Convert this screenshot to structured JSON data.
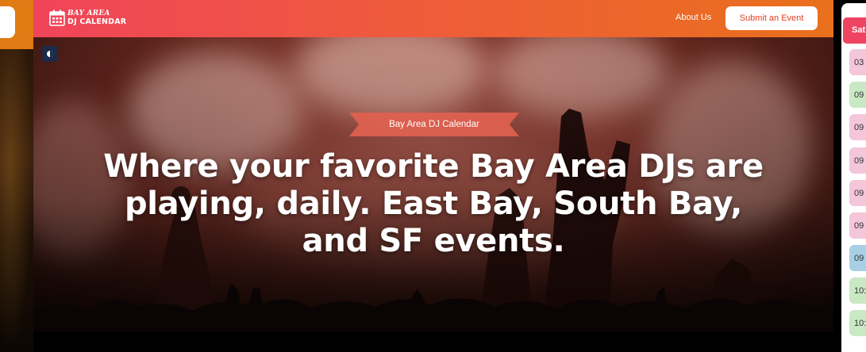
{
  "app": {
    "logo_top": "BAY AREA",
    "logo_bottom": "DJ CALENDAR"
  },
  "nav": {
    "about_label": "About Us",
    "submit_label": "Submit an Event"
  },
  "hero": {
    "ribbon_label": "Bay Area DJ Calendar",
    "headline": "Where your favorite Bay Area DJs are playing, daily. East Bay, South Bay, and SF events."
  },
  "calendar": {
    "day_header": "Sat",
    "times": [
      {
        "text": "03",
        "color": "pink"
      },
      {
        "text": "09",
        "color": "green"
      },
      {
        "text": "09",
        "color": "pink"
      },
      {
        "text": "09",
        "color": "pink"
      },
      {
        "text": "09",
        "color": "pink"
      },
      {
        "text": "09",
        "color": "pink"
      },
      {
        "text": "09",
        "color": "blue"
      },
      {
        "text": "10:",
        "color": "green"
      },
      {
        "text": "10:",
        "color": "green"
      }
    ]
  },
  "colors": {
    "nav_gradient_start": "#f0445a",
    "nav_gradient_end": "#e9701c",
    "accent": "#ef4461",
    "cta_text": "#e0401f"
  },
  "icons": {
    "logo": "calendar-icon",
    "theme_toggle": "theme-toggle-icon"
  }
}
